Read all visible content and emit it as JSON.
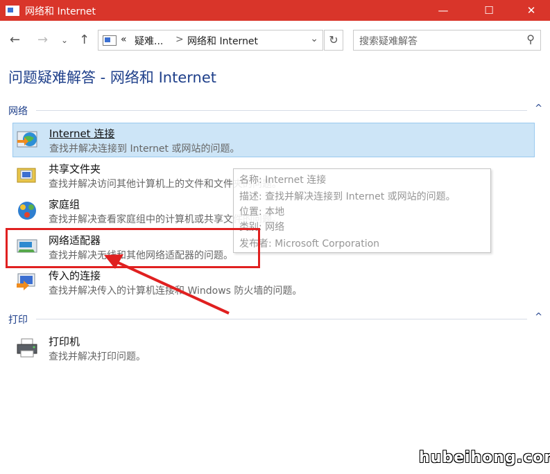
{
  "window": {
    "title": "网络和 Internet"
  },
  "nav": {
    "crumbs": [
      "«",
      "疑难...",
      ">",
      "网络和 Internet"
    ],
    "search_placeholder": "搜索疑难解答"
  },
  "page_title": "问题疑难解答 - 网络和 Internet",
  "sections": [
    {
      "label": "网络"
    },
    {
      "label": "打印"
    }
  ],
  "items": [
    {
      "name": "Internet 连接",
      "desc": "查找并解决连接到 Internet 或网站的问题。"
    },
    {
      "name": "共享文件夹",
      "desc": "查找并解决访问其他计算机上的文件和文件夹的问题。"
    },
    {
      "name": "家庭组",
      "desc": "查找并解决查看家庭组中的计算机或共享文件的问题。"
    },
    {
      "name": "网络适配器",
      "desc": "查找并解决无线和其他网络适配器的问题。"
    },
    {
      "name": "传入的连接",
      "desc": "查找并解决传入的计算机连接和 Windows 防火墙的问题。"
    },
    {
      "name": "打印机",
      "desc": "查找并解决打印问题。"
    }
  ],
  "tooltip": {
    "name": "名称: Internet 连接",
    "desc": "描述: 查找并解决连接到 Internet 或网站的问题。",
    "location": "位置: 本地",
    "category": "类别: 网络",
    "publisher": "发布者: Microsoft Corporation"
  },
  "watermark": "hubeihong.com",
  "colors": {
    "titlebar": "#d9352a",
    "selection": "#cde5f7",
    "annotation": "#e02020",
    "link": "#1e3f8a"
  }
}
